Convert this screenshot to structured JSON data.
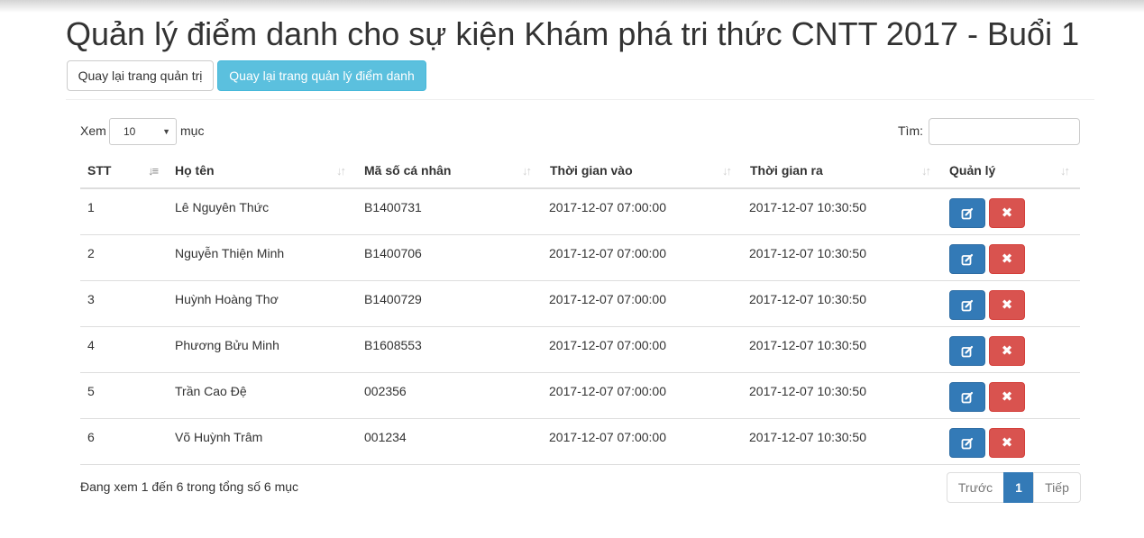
{
  "title": "Quản lý điểm danh cho sự kiện Khám phá tri thức CNTT 2017 - Buổi 1",
  "buttons": {
    "back_admin": "Quay lại trang quản trị",
    "back_attendance": "Quay lại trang quản lý điểm danh"
  },
  "length": {
    "label_before": "Xem",
    "value": "10",
    "label_after": "mục"
  },
  "search": {
    "label": "Tìm:",
    "value": ""
  },
  "columns": [
    "STT",
    "Họ tên",
    "Mã số cá nhân",
    "Thời gian vào",
    "Thời gian ra",
    "Quản lý"
  ],
  "rows": [
    {
      "stt": "1",
      "name": "Lê Nguyên Thức",
      "id": "B1400731",
      "time_in": "2017-12-07 07:00:00",
      "time_out": "2017-12-07 10:30:50"
    },
    {
      "stt": "2",
      "name": "Nguyễn Thiện Minh",
      "id": "B1400706",
      "time_in": "2017-12-07 07:00:00",
      "time_out": "2017-12-07 10:30:50"
    },
    {
      "stt": "3",
      "name": "Huỳnh Hoàng Thơ",
      "id": "B1400729",
      "time_in": "2017-12-07 07:00:00",
      "time_out": "2017-12-07 10:30:50"
    },
    {
      "stt": "4",
      "name": "Phương Bửu Minh",
      "id": "B1608553",
      "time_in": "2017-12-07 07:00:00",
      "time_out": "2017-12-07 10:30:50"
    },
    {
      "stt": "5",
      "name": "Trần Cao Đệ",
      "id": "002356",
      "time_in": "2017-12-07 07:00:00",
      "time_out": "2017-12-07 10:30:50"
    },
    {
      "stt": "6",
      "name": "Võ Huỳnh Trâm",
      "id": "001234",
      "time_in": "2017-12-07 07:00:00",
      "time_out": "2017-12-07 10:30:50"
    }
  ],
  "info": "Đang xem 1 đến 6 trong tổng số 6 mục",
  "pagination": {
    "prev": "Trước",
    "current": "1",
    "next": "Tiếp"
  },
  "icons": {
    "edit": "edit-icon",
    "delete": "delete-icon",
    "sort": "sort-icon",
    "sort_active": "sort-ascending-icon"
  },
  "colors": {
    "info": "#5bc0de",
    "primary": "#337ab7",
    "danger": "#d9534f"
  }
}
